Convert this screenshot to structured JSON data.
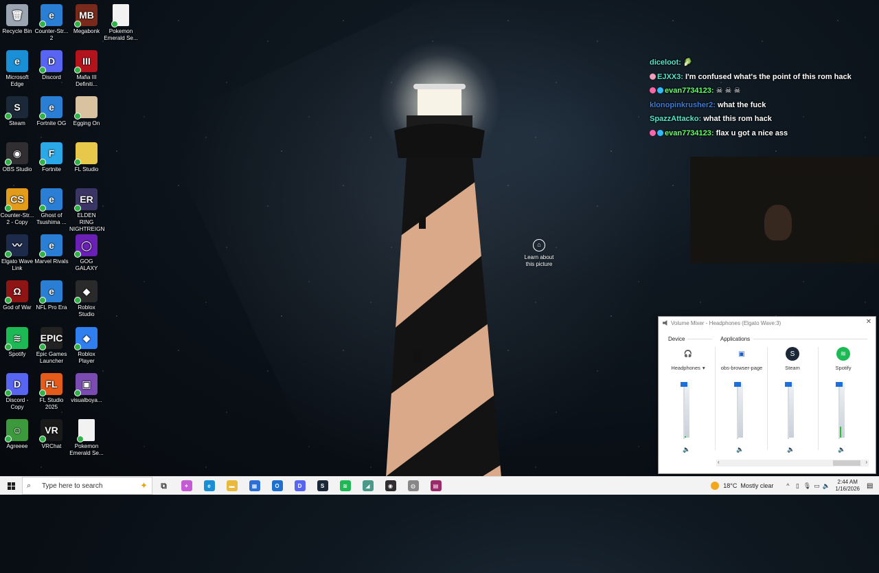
{
  "desktop_icons": [
    {
      "label": "Recycle Bin",
      "color": "#9aa5b1",
      "glyph": "🗑",
      "icon": "recycle-bin-icon"
    },
    {
      "label": "Counter-Str... 2",
      "color": "#2a7fd4",
      "glyph": "e",
      "icon": "ie-shortcut-icon"
    },
    {
      "label": "Megabonk",
      "color": "#7a2a1a",
      "glyph": "MB",
      "icon": "megabonk-icon"
    },
    {
      "label": "Pokemon Emerald Se...",
      "color": "#f2f2f2",
      "glyph": "",
      "icon": "file-icon"
    },
    {
      "label": "Microsoft Edge",
      "color": "#1a8fd6",
      "glyph": "e",
      "icon": "edge-icon"
    },
    {
      "label": "Discord",
      "color": "#5865f2",
      "glyph": "D",
      "icon": "discord-icon"
    },
    {
      "label": "Mafia III Definiti...",
      "color": "#b3141c",
      "glyph": "III",
      "icon": "mafia-icon"
    },
    {
      "label": "Steam",
      "color": "#1b2838",
      "glyph": "S",
      "icon": "steam-icon"
    },
    {
      "label": "Fortnite OG",
      "color": "#2a7fd4",
      "glyph": "e",
      "icon": "ie-shortcut-icon"
    },
    {
      "label": "Egging On",
      "color": "#d9c2a0",
      "glyph": "",
      "icon": "egg-icon"
    },
    {
      "label": "OBS Studio",
      "color": "#302e31",
      "glyph": "◉",
      "icon": "obs-icon"
    },
    {
      "label": "Fortnite",
      "color": "#2aa8e8",
      "glyph": "F",
      "icon": "fortnite-icon"
    },
    {
      "label": "FL Studio",
      "color": "#e8c84a",
      "glyph": "",
      "icon": "folder-icon"
    },
    {
      "label": "Counter-Str... 2 - Copy",
      "color": "#e39b1a",
      "glyph": "CS",
      "icon": "counter-strike-icon"
    },
    {
      "label": "Ghost of Tsushima ...",
      "color": "#2a7fd4",
      "glyph": "e",
      "icon": "ie-shortcut-icon"
    },
    {
      "label": "ELDEN RING NIGHTREIGN",
      "color": "#3b3566",
      "glyph": "ER",
      "icon": "elden-ring-icon"
    },
    {
      "label": "Elgato Wave Link",
      "color": "#1e2a4a",
      "glyph": "〰",
      "icon": "wave-link-icon"
    },
    {
      "label": "Marvel Rivals",
      "color": "#2a7fd4",
      "glyph": "e",
      "icon": "ie-shortcut-icon"
    },
    {
      "label": "GOG GALAXY",
      "color": "#6a1fb5",
      "glyph": "◯",
      "icon": "gog-icon"
    },
    {
      "label": "God of War",
      "color": "#8f1414",
      "glyph": "Ω",
      "icon": "god-of-war-icon"
    },
    {
      "label": "NFL Pro Era",
      "color": "#2a7fd4",
      "glyph": "e",
      "icon": "ie-shortcut-icon"
    },
    {
      "label": "Roblox Studio",
      "color": "#2a2a2a",
      "glyph": "◆",
      "icon": "roblox-studio-icon"
    },
    {
      "label": "Spotify",
      "color": "#1db954",
      "glyph": "≋",
      "icon": "spotify-icon"
    },
    {
      "label": "Epic Games Launcher",
      "color": "#222",
      "glyph": "EPIC",
      "icon": "epic-games-icon"
    },
    {
      "label": "Roblox Player",
      "color": "#2f7ff0",
      "glyph": "◆",
      "icon": "roblox-icon"
    },
    {
      "label": "Discord - Copy",
      "color": "#5865f2",
      "glyph": "D",
      "icon": "discord-icon"
    },
    {
      "label": "FL Studio 2025",
      "color": "#e55b1a",
      "glyph": "FL",
      "icon": "fl-studio-icon"
    },
    {
      "label": "visualboya...",
      "color": "#7a4bb0",
      "glyph": "▣",
      "icon": "visualboy-icon"
    },
    {
      "label": "Agreeee",
      "color": "#3c9a3c",
      "glyph": "☺",
      "icon": "agreeee-icon"
    },
    {
      "label": "VRChat",
      "color": "#1a1a1a",
      "glyph": "VR",
      "icon": "vrchat-icon"
    },
    {
      "label": "Pokemon Emerald Se...",
      "color": "#f2f2f2",
      "glyph": "",
      "icon": "file-icon"
    }
  ],
  "chat": [
    {
      "user": "diceloot:",
      "message": "🥬",
      "color": "#55e6c8",
      "badges": []
    },
    {
      "user": "EJXX3:",
      "message": "I'm confused what's the point of this rom hack",
      "color": "#55e6c8",
      "badges": [
        "#f0a0b8"
      ]
    },
    {
      "user": "evan7734123:",
      "message": "☠ ☠ ☠",
      "color": "#66ff66",
      "badges": [
        "#ff66aa",
        "#33bbff"
      ]
    },
    {
      "user": "klonopinkrusher2:",
      "message": "what the fuck",
      "color": "#3b7bd9",
      "badges": []
    },
    {
      "user": "SpazzAttacko:",
      "message": "what this rom hack",
      "color": "#55e6c8",
      "badges": []
    },
    {
      "user": "evan7734123:",
      "message": "flax u got a nice ass",
      "color": "#66ff66",
      "badges": [
        "#ff66aa",
        "#33bbff"
      ]
    }
  ],
  "learn_about": "Learn about this picture",
  "mixer": {
    "title": "Volume Mixer - Headphones (Elgato Wave:3)",
    "device_label": "Device",
    "applications_label": "Applications",
    "channels": [
      {
        "label": "Headphones",
        "dropdown": "▾",
        "icon": "headphones-icon",
        "color": "#ffffff",
        "glyph": "🎧",
        "level": 0.02
      },
      {
        "label": "obs-browser-page",
        "dropdown": "",
        "icon": "window-icon",
        "color": "#ffffff",
        "glyph": "▣",
        "level": 0
      },
      {
        "label": "Steam",
        "dropdown": "",
        "icon": "steam-icon",
        "color": "#1b2838",
        "glyph": "S",
        "level": 0
      },
      {
        "label": "Spotify",
        "dropdown": "",
        "icon": "spotify-icon",
        "color": "#1db954",
        "glyph": "≋",
        "level": 0.2
      }
    ]
  },
  "taskbar": {
    "search_placeholder": "Type here to search",
    "apps": [
      {
        "icon": "task-view-icon",
        "color": "#555",
        "glyph": "⧉"
      },
      {
        "icon": "copilot-icon",
        "color": "#c65ad6",
        "glyph": "✦"
      },
      {
        "icon": "edge-icon",
        "color": "#1a8fd6",
        "glyph": "e"
      },
      {
        "icon": "file-explorer-icon",
        "color": "#e8b93a",
        "glyph": "▬"
      },
      {
        "icon": "store-icon",
        "color": "#2b6fd6",
        "glyph": "▦"
      },
      {
        "icon": "outlook-icon",
        "color": "#1f6fcf",
        "glyph": "O"
      },
      {
        "icon": "discord-icon",
        "color": "#5865f2",
        "glyph": "D"
      },
      {
        "icon": "steam-icon",
        "color": "#1b2838",
        "glyph": "S"
      },
      {
        "icon": "spotify-icon",
        "color": "#1db954",
        "glyph": "≋"
      },
      {
        "icon": "mint-app-icon",
        "color": "#4a9a8a",
        "glyph": "◢"
      },
      {
        "icon": "obs-icon",
        "color": "#302e31",
        "glyph": "◉"
      },
      {
        "icon": "wave-icon",
        "color": "#888",
        "glyph": "◍"
      },
      {
        "icon": "winrar-icon",
        "color": "#9b2a6a",
        "glyph": "▤"
      }
    ],
    "weather_temp": "18°C",
    "weather_text": "Mostly clear",
    "time": "2:44 AM",
    "date": "1/16/2026"
  }
}
